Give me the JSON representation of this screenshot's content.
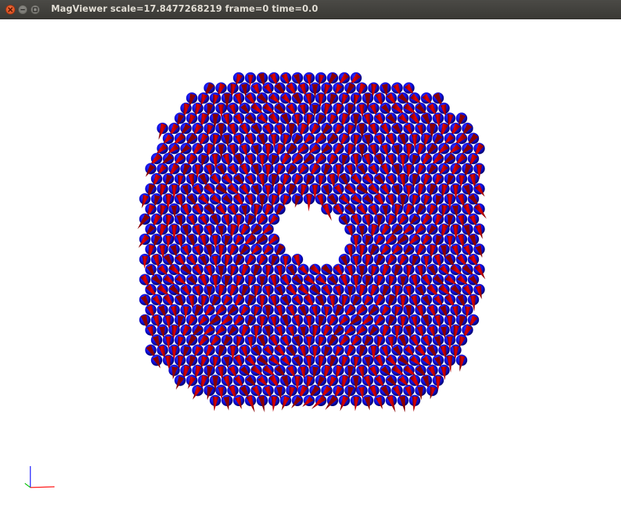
{
  "window": {
    "title": "MagViewer scale=17.8477268219 frame=0 time=0.0",
    "buttons": [
      "close",
      "minimize",
      "maximize"
    ]
  },
  "scene": {
    "object": "torus of magnetic spins",
    "colors": {
      "background": "#ffffff",
      "sphere": "#1010e0",
      "sphere_dark": "#00006e",
      "arrow": "#d40000",
      "arrow_dark": "#6a0000"
    },
    "axes": {
      "x_color": "#ff0000",
      "y_color": "#0000ff",
      "z_color": "#00c000"
    }
  }
}
